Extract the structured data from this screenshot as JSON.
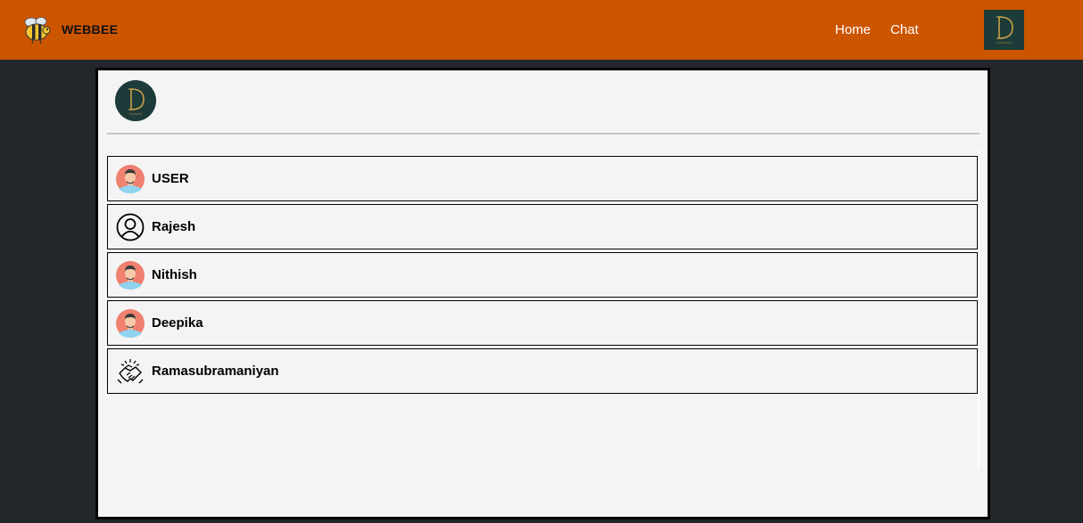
{
  "navbar": {
    "brand_name": "WEBBEE",
    "brand_logo_icon": "bee-icon",
    "links": [
      {
        "label": "Home"
      },
      {
        "label": "Chat"
      }
    ],
    "avatar_icon": "d-monogram-icon",
    "color": "#cc5500"
  },
  "panel": {
    "profile_avatar_icon": "d-monogram-icon",
    "users": [
      {
        "name": "USER",
        "avatar_icon": "man-avatar-icon"
      },
      {
        "name": "Rajesh",
        "avatar_icon": "person-outline-icon"
      },
      {
        "name": "Nithish",
        "avatar_icon": "man-avatar-icon"
      },
      {
        "name": "Deepika",
        "avatar_icon": "man-avatar-icon"
      },
      {
        "name": "Ramasubramaniyan",
        "avatar_icon": "handshake-icon"
      }
    ]
  },
  "colors": {
    "page_background": "#23262b",
    "panel_background": "#f4f4f4",
    "avatar_dark_green": "#1d3b38",
    "monogram_gold": "#c9a04a"
  }
}
